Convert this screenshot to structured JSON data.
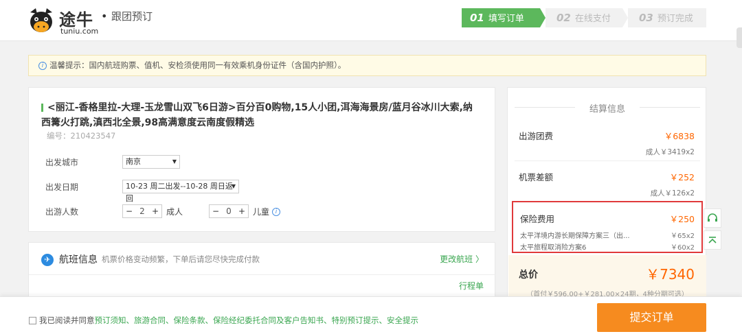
{
  "header": {
    "logo_cn": "途牛",
    "logo_en": "tuniu.com",
    "logo_dot": "•",
    "subtitle": "跟团预订",
    "steps": [
      {
        "num": "01",
        "label": "填写订单",
        "active": true
      },
      {
        "num": "02",
        "label": "在线支付",
        "active": false
      },
      {
        "num": "03",
        "label": "预订完成",
        "active": false
      }
    ]
  },
  "notice": {
    "icon": "info-icon",
    "text": "温馨提示：国内航班购票、值机、安检须使用同一有效乘机身份证件（含国内护照）。"
  },
  "product": {
    "title": "<丽江-香格里拉-大理-玉龙雪山双飞6日游>百分百0购物,15人小团,洱海海景房/蓝月谷冰川大索,纳西篝火打跳,滇西北全景,98高满意度云南度假精选",
    "code": "编号：210423547",
    "depart_city_label": "出发城市",
    "depart_city_value": "南京",
    "depart_date_label": "出发日期",
    "depart_date_value": "10-23 周二出发--10-28 周日返回",
    "people_label": "出游人数",
    "adult_count": "2",
    "adult_unit": "成人",
    "child_count": "0",
    "child_unit": "儿童",
    "minus": "−",
    "plus": "+",
    "caret": "▼"
  },
  "flight": {
    "icon": "plane-icon",
    "title": "航班信息",
    "hint": "机票价格变动频繁，下单后请您尽快完成付款",
    "change": "更改航班 〉",
    "itinerary": "行程单"
  },
  "summary": {
    "heading": "结算信息",
    "tour_label": "出游团费",
    "tour_amount": "￥6838",
    "tour_detail": "成人￥3419x2",
    "air_label": "机票差额",
    "air_amount": "￥252",
    "air_detail": "成人￥126x2",
    "ins_label": "保险费用",
    "ins_amount": "￥250",
    "ins_items": [
      {
        "name": "太平洋境内游长期保障方案三（出...",
        "price": "￥65x2"
      },
      {
        "name": "太平旅程取消险方案6",
        "price": "￥60x2"
      }
    ],
    "total_label": "总价",
    "total_amount": "￥7340",
    "total_note": "（首付￥596.00+￥281.00×24期，4种分期可选）"
  },
  "footer": {
    "agree_prefix": "我已阅读并同意",
    "links": [
      "预订须知、",
      "旅游合同、",
      "保险条款、",
      "保险经纪委托合同及客户告知书、",
      "特别预订提示、",
      "安全提示"
    ],
    "submit": "提交订单"
  },
  "colors": {
    "brand_green": "#5cb85c",
    "orange": "#f68b1f",
    "price": "#ff6600",
    "highlight_red": "#e0393a"
  }
}
